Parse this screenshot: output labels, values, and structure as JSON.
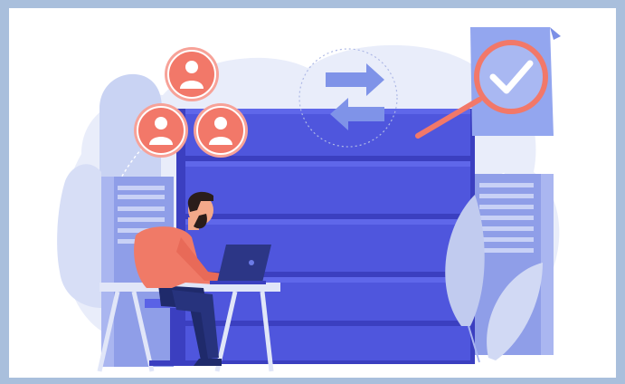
{
  "colors": {
    "border": "#a9bfdc",
    "background": "#ffffff",
    "bg_blob": "#e6eaf9",
    "bg_blob_dark": "#d3dbf3",
    "server_dark": "#3b3fc0",
    "server_mid": "#4a51d6",
    "server_light": "#5a62e6",
    "side_rack": "#8f9ee8",
    "side_rack_light": "#aab6f0",
    "accent": "#f27869",
    "accent_light": "#f7a298",
    "person_shirt": "#f07a67",
    "person_pants": "#1f2a6b",
    "hair": "#2a1d1a",
    "skin": "#f3a98a",
    "laptop": "#2c3686",
    "table": "#c5d0f2",
    "arrow": "#7f93e8",
    "document": "#93a6ef",
    "check": "#ffffff"
  },
  "icons": {
    "user_avatars": [
      "user-avatar-icon",
      "user-avatar-icon",
      "user-avatar-icon"
    ],
    "exchange_arrows": "exchange-arrows-icon",
    "magnifier": "magnifying-glass-icon",
    "checkmark": "checkmark-icon",
    "document": "document-icon"
  }
}
